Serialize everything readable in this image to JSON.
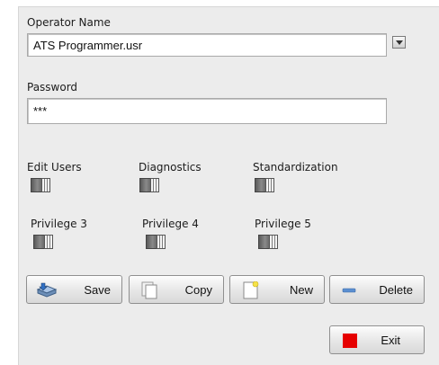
{
  "operator": {
    "label": "Operator Name",
    "value": "ATS Programmer.usr"
  },
  "password": {
    "label": "Password",
    "value": "***"
  },
  "privileges": [
    {
      "label": "Edit Users",
      "on": false
    },
    {
      "label": "Diagnostics",
      "on": false
    },
    {
      "label": "Standardization",
      "on": false
    },
    {
      "label": "Privilege 3",
      "on": false
    },
    {
      "label": "Privilege 4",
      "on": false
    },
    {
      "label": "Privilege 5",
      "on": false
    }
  ],
  "buttons": {
    "save": "Save",
    "copy": "Copy",
    "new": "New",
    "delete": "Delete",
    "exit": "Exit"
  },
  "colors": {
    "panel": "#ececec",
    "exit_icon": "#e60000",
    "delete_icon": "#5b8fd1"
  },
  "icons": {
    "dropdown": "dropdown-arrow-icon",
    "save": "save-drive-icon",
    "copy": "copy-pages-icon",
    "new": "new-document-icon",
    "delete": "minus-icon",
    "exit": "stop-square-icon"
  }
}
